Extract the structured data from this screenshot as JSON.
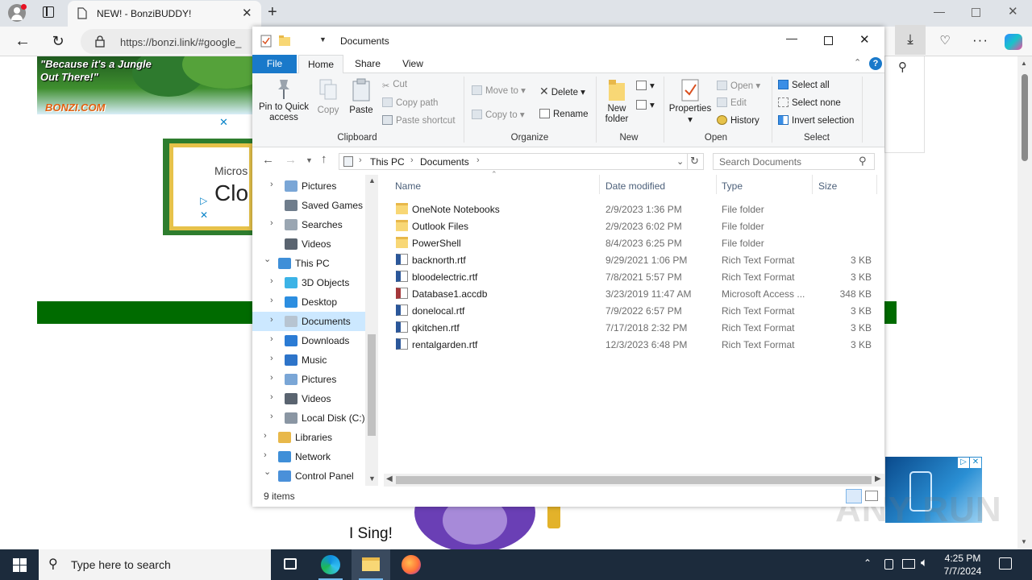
{
  "browser": {
    "tab_title": "NEW! - BonziBUDDY!",
    "url": "https://bonzi.link/#google_"
  },
  "webpage": {
    "banner_text": "\"Because it's a Jungle Out There!\"",
    "logo_text": "BONZI.COM",
    "ad_text_1": "Micros",
    "ad_text_2": "Clo",
    "sing_text": "I Sing!",
    "colors": {
      "green_bar": "#006b00",
      "jungle_dark": "#1f5a1f",
      "ad_blue": "#0a4a8c"
    }
  },
  "explorer": {
    "window_title": "Documents",
    "ribbon_tabs": [
      "File",
      "Home",
      "Share",
      "View"
    ],
    "clipboard": {
      "pin": "Pin to Quick access",
      "copy": "Copy",
      "paste": "Paste",
      "cut": "Cut",
      "copy_path": "Copy path",
      "paste_shortcut": "Paste shortcut",
      "label": "Clipboard"
    },
    "organize": {
      "move_to": "Move to",
      "copy_to": "Copy to",
      "delete": "Delete",
      "rename": "Rename",
      "label": "Organize"
    },
    "new_group": {
      "new_folder": "New folder",
      "label": "New"
    },
    "open_group": {
      "properties": "Properties",
      "open": "Open",
      "edit": "Edit",
      "history": "History",
      "label": "Open"
    },
    "select_group": {
      "select_all": "Select all",
      "select_none": "Select none",
      "invert": "Invert selection",
      "label": "Select"
    },
    "breadcrumb": [
      "This PC",
      "Documents"
    ],
    "search_placeholder": "Search Documents",
    "nav_items": [
      {
        "label": "Pictures",
        "level": 2,
        "icon": "pictures-icon",
        "expander": "collapsed"
      },
      {
        "label": "Saved Games",
        "level": 2,
        "icon": "saved-games-icon",
        "expander": "none"
      },
      {
        "label": "Searches",
        "level": 2,
        "icon": "search-icon",
        "expander": "collapsed"
      },
      {
        "label": "Videos",
        "level": 2,
        "icon": "videos-icon",
        "expander": "none"
      },
      {
        "label": "This PC",
        "level": 1,
        "icon": "this-pc-icon",
        "expander": "expanded"
      },
      {
        "label": "3D Objects",
        "level": 2,
        "icon": "3d-objects-icon",
        "expander": "collapsed"
      },
      {
        "label": "Desktop",
        "level": 2,
        "icon": "desktop-icon",
        "expander": "collapsed"
      },
      {
        "label": "Documents",
        "level": 2,
        "icon": "documents-icon",
        "expander": "collapsed",
        "selected": true
      },
      {
        "label": "Downloads",
        "level": 2,
        "icon": "downloads-icon",
        "expander": "collapsed"
      },
      {
        "label": "Music",
        "level": 2,
        "icon": "music-icon",
        "expander": "collapsed"
      },
      {
        "label": "Pictures",
        "level": 2,
        "icon": "pictures-icon",
        "expander": "collapsed"
      },
      {
        "label": "Videos",
        "level": 2,
        "icon": "videos-icon",
        "expander": "collapsed"
      },
      {
        "label": "Local Disk (C:)",
        "level": 2,
        "icon": "drive-icon",
        "expander": "collapsed"
      },
      {
        "label": "Libraries",
        "level": 1,
        "icon": "libraries-icon",
        "expander": "collapsed"
      },
      {
        "label": "Network",
        "level": 1,
        "icon": "network-icon",
        "expander": "collapsed"
      },
      {
        "label": "Control Panel",
        "level": 1,
        "icon": "control-panel-icon",
        "expander": "expanded"
      }
    ],
    "columns": [
      "Name",
      "Date modified",
      "Type",
      "Size"
    ],
    "files": [
      {
        "name": "OneNote Notebooks",
        "date": "2/9/2023 1:36 PM",
        "type": "File folder",
        "size": "",
        "icon": "folder-icon"
      },
      {
        "name": "Outlook Files",
        "date": "2/9/2023 6:02 PM",
        "type": "File folder",
        "size": "",
        "icon": "folder-icon"
      },
      {
        "name": "PowerShell",
        "date": "8/4/2023 6:25 PM",
        "type": "File folder",
        "size": "",
        "icon": "folder-icon"
      },
      {
        "name": "backnorth.rtf",
        "date": "9/29/2021 1:06 PM",
        "type": "Rich Text Format",
        "size": "3 KB",
        "icon": "rtf-icon"
      },
      {
        "name": "bloodelectric.rtf",
        "date": "7/8/2021 5:57 PM",
        "type": "Rich Text Format",
        "size": "3 KB",
        "icon": "rtf-icon"
      },
      {
        "name": "Database1.accdb",
        "date": "3/23/2019 11:47 AM",
        "type": "Microsoft Access ...",
        "size": "348 KB",
        "icon": "access-icon"
      },
      {
        "name": "donelocal.rtf",
        "date": "7/9/2022 6:57 PM",
        "type": "Rich Text Format",
        "size": "3 KB",
        "icon": "rtf-icon"
      },
      {
        "name": "qkitchen.rtf",
        "date": "7/17/2018 2:32 PM",
        "type": "Rich Text Format",
        "size": "3 KB",
        "icon": "rtf-icon"
      },
      {
        "name": "rentalgarden.rtf",
        "date": "12/3/2023 6:48 PM",
        "type": "Rich Text Format",
        "size": "3 KB",
        "icon": "rtf-icon"
      }
    ],
    "status": "9 items"
  },
  "taskbar": {
    "search_placeholder": "Type here to search",
    "time": "4:25 PM",
    "date": "7/7/2024"
  },
  "watermark": "ANY RUN"
}
